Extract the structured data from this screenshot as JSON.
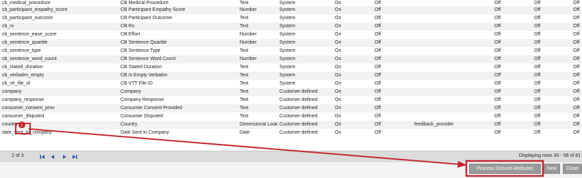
{
  "rows": [
    {
      "name": "cb_medical_procedure",
      "display": "CB Medical Procedure",
      "type": "Text",
      "source": "System",
      "f1": "On",
      "f2": "Off",
      "extra": "",
      "g1": "Off",
      "g2": "Off",
      "g3": "Off"
    },
    {
      "name": "cb_participant_empathy_score",
      "display": "CB Participant Empathy Score",
      "type": "Number",
      "source": "System",
      "f1": "On",
      "f2": "Off",
      "extra": "",
      "g1": "Off",
      "g2": "Off",
      "g3": "Off"
    },
    {
      "name": "cb_participant_outcome",
      "display": "CB Participant Outcome",
      "type": "Text",
      "source": "System",
      "f1": "On",
      "f2": "Off",
      "extra": "",
      "g1": "Off",
      "g2": "Off",
      "g3": "Off"
    },
    {
      "name": "cb_rx",
      "display": "CB Rx",
      "type": "Text",
      "source": "System",
      "f1": "On",
      "f2": "Off",
      "extra": "",
      "g1": "Off",
      "g2": "Off",
      "g3": "Off"
    },
    {
      "name": "cb_sentence_ease_score",
      "display": "CB Effort",
      "type": "Number",
      "source": "System",
      "f1": "On",
      "f2": "Off",
      "extra": "",
      "g1": "Off",
      "g2": "Off",
      "g3": "Off"
    },
    {
      "name": "cb_sentence_quartile",
      "display": "CB Sentence Quartile",
      "type": "Number",
      "source": "System",
      "f1": "On",
      "f2": "Off",
      "extra": "",
      "g1": "Off",
      "g2": "Off",
      "g3": "Off"
    },
    {
      "name": "cb_sentence_type",
      "display": "CB Sentence Type",
      "type": "Text",
      "source": "System",
      "f1": "On",
      "f2": "Off",
      "extra": "",
      "g1": "Off",
      "g2": "Off",
      "g3": "Off"
    },
    {
      "name": "cb_sentence_word_count",
      "display": "CB Sentence Word Count",
      "type": "Number",
      "source": "System",
      "f1": "On",
      "f2": "Off",
      "extra": "",
      "g1": "Off",
      "g2": "Off",
      "g3": "Off"
    },
    {
      "name": "cb_stated_duration",
      "display": "CB Stated Duration",
      "type": "Text",
      "source": "System",
      "f1": "On",
      "f2": "Off",
      "extra": "",
      "g1": "Off",
      "g2": "Off",
      "g3": "Off"
    },
    {
      "name": "cb_verbatim_empty",
      "display": "CB Is Empty Verbatim",
      "type": "Text",
      "source": "System",
      "f1": "On",
      "f2": "Off",
      "extra": "",
      "g1": "Off",
      "g2": "Off",
      "g3": "Off"
    },
    {
      "name": "cb_vtt_file_id",
      "display": "CB VTT File ID",
      "type": "Text",
      "source": "System",
      "f1": "On",
      "f2": "Off",
      "extra": "",
      "g1": "Off",
      "g2": "Off",
      "g3": "Off"
    },
    {
      "name": "company",
      "display": "Company",
      "type": "Text",
      "source": "Customer-defined",
      "f1": "On",
      "f2": "Off",
      "extra": "",
      "g1": "Off",
      "g2": "Off",
      "g3": "Off"
    },
    {
      "name": "company_response",
      "display": "Company Response",
      "type": "Text",
      "source": "Customer-defined",
      "f1": "On",
      "f2": "Off",
      "extra": "",
      "g1": "Off",
      "g2": "Off",
      "g3": "Off"
    },
    {
      "name": "consumer_consent_prov",
      "display": "Consumer Consent Provided",
      "type": "Text",
      "source": "Customer-defined",
      "f1": "On",
      "f2": "Off",
      "extra": "",
      "g1": "Off",
      "g2": "Off",
      "g3": "Off"
    },
    {
      "name": "consumer_disputed",
      "display": "Consumer Disputed",
      "type": "Text",
      "source": "Customer-defined",
      "f1": "On",
      "f2": "Off",
      "extra": "",
      "g1": "Off",
      "g2": "Off",
      "g3": "Off"
    },
    {
      "name": "country",
      "display": "Country",
      "type": "Dimensional Looku",
      "source": "Customer-defined",
      "f1": "On",
      "f2": "Off",
      "extra": "feedback_provider",
      "g1": "Off",
      "g2": "Off",
      "g3": "Off"
    },
    {
      "name": "date_sent_to_company",
      "display": "Date Sent to Company",
      "type": "Date",
      "source": "Customer-defined",
      "f1": "On",
      "f2": "Off",
      "extra": "",
      "g1": "Off",
      "g2": "Off",
      "g3": "Off"
    }
  ],
  "warning_icon": {
    "name": "exclamation-icon",
    "glyph": "!",
    "color": "#c4262e"
  },
  "pager": {
    "page_info": "2 of 3",
    "rows_info": "Displaying rows 30 - 58 of 81"
  },
  "buttons": {
    "process": "Process Derived Attributes",
    "new": "New",
    "close": "Close"
  },
  "colors": {
    "annotation": "#c4262e",
    "button_bg": "#9a9a9a",
    "nav_icon": "#2a52a8"
  }
}
